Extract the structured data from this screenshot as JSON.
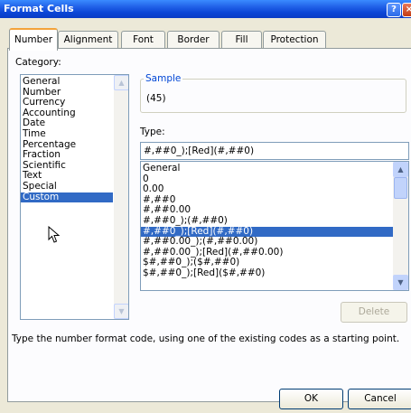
{
  "window": {
    "title": "Format Cells",
    "help_glyph": "?",
    "close_glyph": "×"
  },
  "tabs": [
    {
      "label": "Number",
      "active": true
    },
    {
      "label": "Alignment"
    },
    {
      "label": "Font"
    },
    {
      "label": "Border"
    },
    {
      "label": "Fill"
    },
    {
      "label": "Protection"
    }
  ],
  "category": {
    "label": "Category:",
    "items": [
      "General",
      "Number",
      "Currency",
      "Accounting",
      "Date",
      "Time",
      "Percentage",
      "Fraction",
      "Scientific",
      "Text",
      "Special",
      "Custom"
    ],
    "selected": "Custom"
  },
  "sample": {
    "label": "Sample",
    "value": "(45)"
  },
  "type": {
    "label": "Type:",
    "value": "#,##0_);[Red](#,##0)",
    "items": [
      "General",
      "0",
      "0.00",
      "#,##0",
      "#,##0.00",
      "#,##0_);(#,##0)",
      "#,##0_);[Red](#,##0)",
      "#,##0.00_);(#,##0.00)",
      "#,##0.00_);[Red](#,##0.00)",
      "$#,##0_);($#,##0)",
      "$#,##0_);[Red]($#,##0)"
    ],
    "selected": "#,##0_);[Red](#,##0)"
  },
  "buttons": {
    "delete": "Delete",
    "ok": "OK",
    "cancel": "Cancel"
  },
  "hint": "Type the number format code, using one of the existing codes as a starting point.",
  "icons": {
    "scroll_up": "▲",
    "scroll_down": "▼"
  },
  "colors": {
    "selection": "#316ac5",
    "titlebar": "#0a3cc4"
  }
}
